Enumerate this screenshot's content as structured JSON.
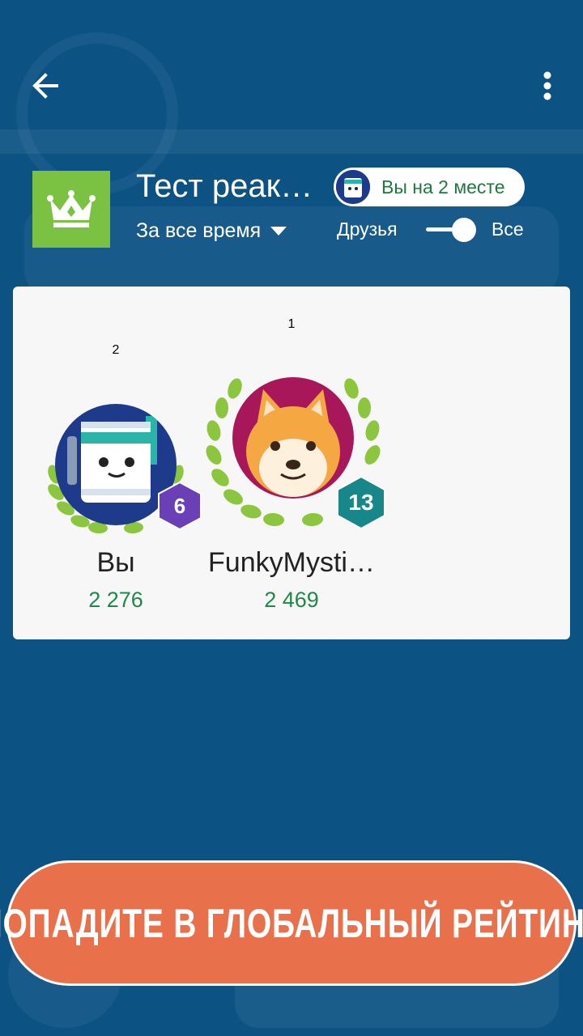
{
  "header": {
    "test_title": "Тест реак…",
    "rank_text": "Вы на 2 месте",
    "period": "За все время",
    "friends_label": "Друзья",
    "all_label": "Все",
    "toggle_on": true
  },
  "leaderboard": [
    {
      "rank": "2",
      "name": "Вы",
      "score": "2 276",
      "level": "6",
      "level_color": "#6b3fb5",
      "avatar": "robot-icon"
    },
    {
      "rank": "1",
      "name": "FunkyMysti…",
      "score": "2 469",
      "level": "13",
      "level_color": "#17878a",
      "avatar": "shiba-dog-icon"
    }
  ],
  "cta": {
    "label": "ПОПАДИТЕ В ГЛОБАЛЬНЫЙ РЕЙТИНГ"
  },
  "colors": {
    "background": "#0c5384",
    "crown_box": "#7cc242",
    "score_green": "#1e8a48",
    "cta": "#e8704a"
  }
}
